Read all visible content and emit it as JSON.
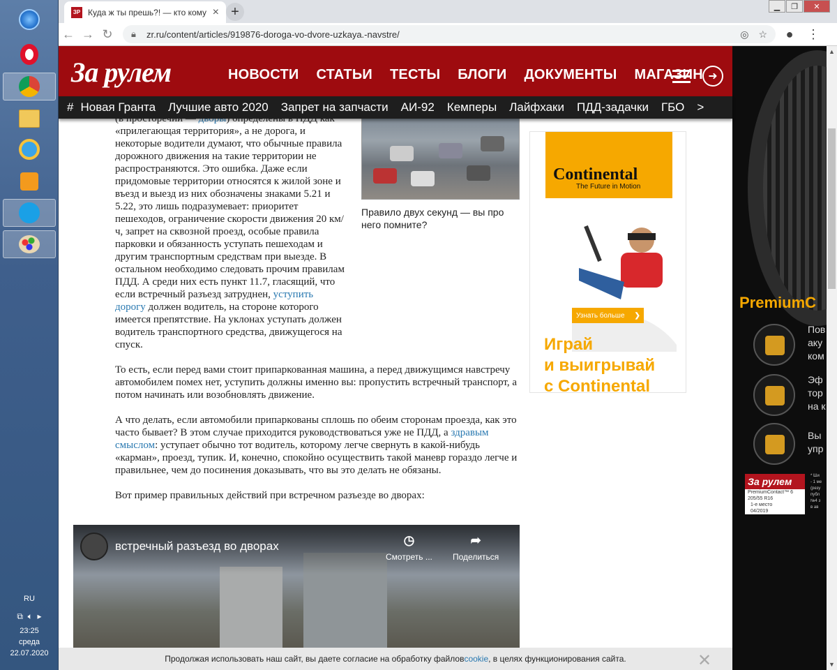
{
  "taskbar": {
    "lang": "RU",
    "time": "23:25",
    "weekday": "среда",
    "date": "22.07.2020"
  },
  "browser": {
    "tab_title": "Куда ж ты прешь?! — кто кому",
    "favicon_text": "ЗР",
    "url": "zr.ru/content/articles/919876-doroga-vo-dvore-uzkaya.-navstre/"
  },
  "site": {
    "logo": "За рулем",
    "menu": [
      "НОВОСТИ",
      "СТАТЬИ",
      "ТЕСТЫ",
      "БЛОГИ",
      "ДОКУМЕНТЫ",
      "МАГАЗИН"
    ],
    "tags_hash": "#",
    "tags": [
      "Новая Гранта",
      "Лучшие авто 2020",
      "Запрет на запчасти",
      "АИ-92",
      "Кемперы",
      "Лайфхаки",
      "ПДД-задачки",
      "ГБО"
    ],
    "tags_more": ">",
    "brand_color": "#9e0b0f"
  },
  "article": {
    "p1_a": "(в просторечии — ",
    "p1_link": "дворы",
    "p1_b": ") определены в ПДД как «прилегающая территория», а не дорога, и некоторые водители думают, что обычные правила дорожного движения на такие территории не распространяются. Это ошибка. Даже если придомовые территории относятся к жилой зоне и въезд и выезд из них обозначены знаками 5.21 и 5.22, это лишь подразумевает: приоритет пешеходов, ограничение скорости движения 20 км/ч, запрет на сквозной проезд, особые правила парковки и обязанность уступать пешеходам и другим транспортным средствам при выезде. В остальном необходимо следовать прочим правилам ПДД. А среди них есть пункт 11.7, гласящий, что если встречный разъезд затруднен, ",
    "p1_link2": "уступить дорогу",
    "p1_c": " должен водитель, на стороне которого имеется препятствие. На уклонах уступать должен водитель транспортного средства, движущегося на спуск.",
    "p2": "То есть, если перед вами стоит припаркованная машина, а перед движущимся навстречу автомобилем помех нет, уступить должны именно вы: пропустить встречный транспорт, а потом начинать или возобновлять движение.",
    "p3_a": "А что делать, если автомобили припаркованы сплошь по обеим сторонам проезда, как это часто бывает? В этом случае приходится руководствоваться уже не ПДД, а ",
    "p3_link": "здравым смыслом",
    "p3_b": ": уступает обычно тот водитель, которому легче свернуть в какой-нибудь «карман», проезд, тупик. И, конечно, спокойно осуществить такой маневр гораздо легче и правильнее, чем до посинения доказывать, что вы это делать не обязаны.",
    "p4": "Вот пример правильных действий при встречном разъезде во дворах:",
    "caption": "Правило двух секунд — вы про него помните?"
  },
  "ad_continental": {
    "brand": "Continental",
    "tagline": "The Future in Motion",
    "button": "Узнать больше",
    "button_arrow": "❯",
    "slogan_1": "Играй",
    "slogan_2": "и выигрывай",
    "slogan_3": "с Continental"
  },
  "ad_tyre": {
    "product": "PremiumC",
    "f1": [
      "Пов",
      "аку",
      "ком"
    ],
    "f2": [
      "Эф",
      "тор",
      "на к"
    ],
    "f3": [
      "Вы",
      "упр"
    ],
    "logo": "За рулем",
    "logo_sub": "PremiumContact™ 6",
    "logo_size": "205/55 R16",
    "logo_place": "1-е место",
    "logo_date": "04/2019",
    "fine": [
      "* Ши",
      "- 1 ме",
      "(резу",
      "публ",
      "№4 з",
      "в ав"
    ]
  },
  "video": {
    "title": "встречный разъезд во дворах",
    "watch_later": "Смотреть ...",
    "share": "Поделиться"
  },
  "cookie": {
    "text_a": "Продолжая использовать наш сайт, вы даете согласие на обработку файлов ",
    "link": "cookie",
    "text_b": ", в целях функционирования сайта.",
    "close": "✕"
  }
}
